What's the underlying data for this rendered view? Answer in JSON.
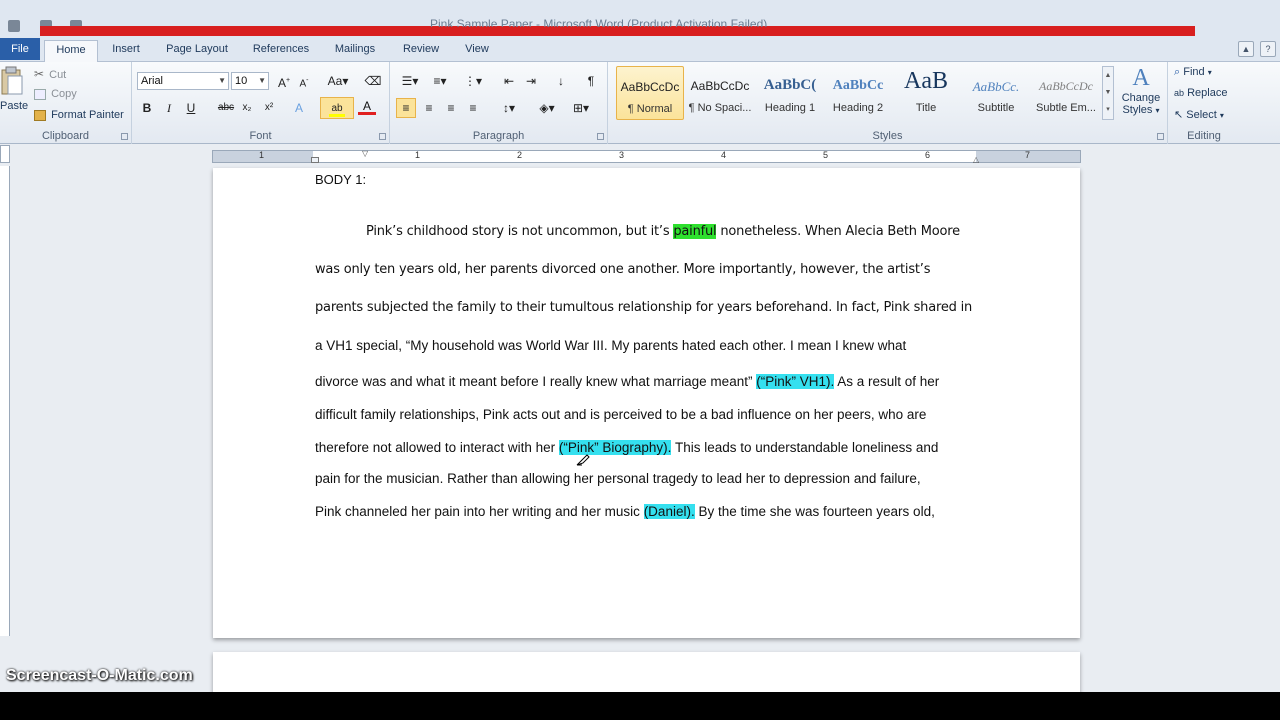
{
  "window": {
    "title": "Pink Sample Paper - Microsoft Word (Product Activation Failed)"
  },
  "tabs": [
    {
      "label": "File"
    },
    {
      "label": "Home"
    },
    {
      "label": "Insert"
    },
    {
      "label": "Page Layout"
    },
    {
      "label": "References"
    },
    {
      "label": "Mailings"
    },
    {
      "label": "Review"
    },
    {
      "label": "View"
    }
  ],
  "clipboard": {
    "paste_label": "Paste",
    "cut_label": "Cut",
    "copy_label": "Copy",
    "format_painter_label": "Format Painter",
    "group_label": "Clipboard"
  },
  "font": {
    "family": "Arial",
    "size": "10",
    "group_label": "Font"
  },
  "paragraph": {
    "group_label": "Paragraph"
  },
  "styles": {
    "items": [
      {
        "sample": "AaBbCcDc",
        "name": "¶ Normal"
      },
      {
        "sample": "AaBbCcDc",
        "name": "¶ No Spaci..."
      },
      {
        "sample": "AaBbC(",
        "name": "Heading 1"
      },
      {
        "sample": "AaBbCc",
        "name": "Heading 2"
      },
      {
        "sample": "AaB",
        "name": "Title"
      },
      {
        "sample": "AaBbCc.",
        "name": "Subtitle"
      },
      {
        "sample": "AaBbCcDc",
        "name": "Subtle Em..."
      }
    ],
    "change_styles_line1": "Change",
    "change_styles_line2": "Styles",
    "group_label": "Styles"
  },
  "editing": {
    "find_label": "Find",
    "replace_label": "Replace",
    "select_label": "Select",
    "group_label": "Editing"
  },
  "ruler": {
    "numbers": [
      "1",
      "1",
      "2",
      "3",
      "4",
      "5",
      "6",
      "7"
    ]
  },
  "document": {
    "heading": "BODY 1:",
    "lines": [
      {
        "before": "Pink’s childhood story is not uncommon, but it’s ",
        "hl": "painful",
        "after": " nonetheless.  When Alecia Beth Moore"
      },
      {
        "text": "was only ten years old, her parents divorced one another.  More importantly, however, the artist’s"
      },
      {
        "text": "parents subjected the family to their tumultous  relationship for years beforehand.   In fact, Pink shared in"
      },
      {
        "text": "a VH1 special, “My household was World War III. My parents hated each other. I mean I knew what"
      },
      {
        "before": "divorce was and what it meant before I really knew what marriage meant” ",
        "hl": "(“Pink” VH1).",
        "after": " As a result of her"
      },
      {
        "text": "difficult family relationships, Pink acts out and is perceived to be a bad influence on her peers, who are"
      },
      {
        "before": "therefore not allowed to interact with her ",
        "hl": "(“Pink” Biography).",
        "after": "  This leads to understandable loneliness  and"
      },
      {
        "text": "pain for the musician.  Rather than allowing  her personal tragedy to lead her to depression and failure,"
      },
      {
        "before": "Pink channeled her pain into her writing and her music ",
        "hl": "(Daniel).",
        "after": " By the time she was fourteen years old,"
      }
    ]
  },
  "watermark": "Screencast-O-Matic.com",
  "colors": {
    "highlight_green": "#2ee02e",
    "highlight_cyan": "#35e0ef",
    "file_tab": "#2a5fa8"
  }
}
